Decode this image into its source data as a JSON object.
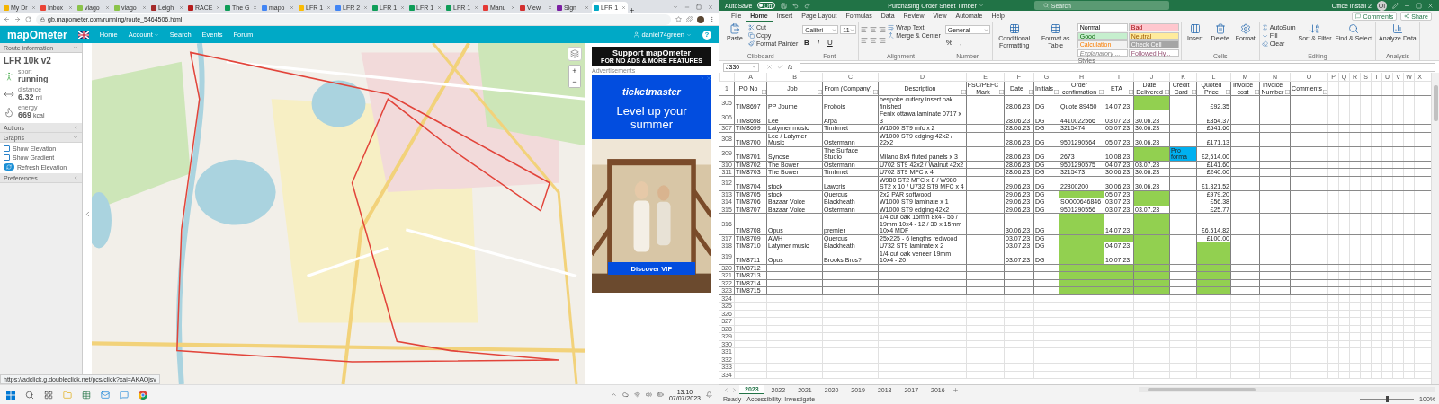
{
  "browser": {
    "tabs": [
      {
        "label": "My Dr",
        "color": "#f4b400",
        "selected": false
      },
      {
        "label": "Inbox",
        "color": "#ea4335",
        "selected": false
      },
      {
        "label": "viago",
        "color": "#8bc34a",
        "selected": false
      },
      {
        "label": "viago",
        "color": "#8bc34a",
        "selected": false
      },
      {
        "label": "Leigh",
        "color": "#a52a2a",
        "selected": false
      },
      {
        "label": "RACE",
        "color": "#b71c1c",
        "selected": false
      },
      {
        "label": "The G",
        "color": "#0f9d58",
        "selected": false
      },
      {
        "label": "mapo",
        "color": "#4285f4",
        "selected": false
      },
      {
        "label": "LFR 1",
        "color": "#fbbc04",
        "selected": false
      },
      {
        "label": "LFR 2",
        "color": "#4285f4",
        "selected": false
      },
      {
        "label": "LFR 1",
        "color": "#0f9d58",
        "selected": false
      },
      {
        "label": "LFR 1",
        "color": "#0f9d58",
        "selected": false
      },
      {
        "label": "LFR 1",
        "color": "#0f9d58",
        "selected": false
      },
      {
        "label": "Manu",
        "color": "#e53935",
        "selected": false
      },
      {
        "label": "View",
        "color": "#d32f2f",
        "selected": false
      },
      {
        "label": "Sign",
        "color": "#7b1fa2",
        "selected": false
      },
      {
        "label": "LFR 1",
        "color": "#00a9c6",
        "selected": true
      }
    ],
    "address": "gb.mapometer.com/running/route_5464506.html",
    "status_url": "https://adclick.g.doubleclick.net/pcs/click?xai=AKAOjsv"
  },
  "site": {
    "logo": "mapOmeter",
    "nav": [
      {
        "label": "Home",
        "dropdown": false
      },
      {
        "label": "Account",
        "dropdown": true
      },
      {
        "label": "Search",
        "dropdown": false
      },
      {
        "label": "Events",
        "dropdown": false
      },
      {
        "label": "Forum",
        "dropdown": false
      }
    ],
    "user": "daniel74green",
    "help": "?"
  },
  "sidebar": {
    "panel_title": "Route information",
    "route_name": "LFR 10k v2",
    "stats": [
      {
        "kind": "sport",
        "label": "sport",
        "value": "running"
      },
      {
        "kind": "distance",
        "label": "distance",
        "value": "6.32",
        "unit": "mi"
      },
      {
        "kind": "energy",
        "label": "energy",
        "value": "669",
        "unit": "kcal"
      }
    ],
    "sections": [
      {
        "label": "Actions",
        "expanded": false
      },
      {
        "label": "Graphs",
        "expanded": true,
        "options": [
          {
            "label": "Show Elevation",
            "checked": false
          },
          {
            "label": "Show Gradient",
            "checked": false
          }
        ],
        "button": "Refresh Elevation"
      },
      {
        "label": "Preferences",
        "expanded": false
      }
    ]
  },
  "map": {
    "kind": "picture",
    "zoom_in": "+",
    "zoom_out": "−"
  },
  "ad": {
    "support_title": "Support mapOmeter",
    "support_subtitle": "FOR NO ADS & MORE FEATURES",
    "label": "Advertisements",
    "brand": "ticketmaster",
    "headline": "Level up your summer",
    "cta": "Discover VIP"
  },
  "taskbar": {
    "time": "13:10",
    "date": "07/07/2023"
  },
  "excel": {
    "autosave": {
      "label": "AutoSave",
      "on": false,
      "state": "Off"
    },
    "title": "Purchasing Order Sheet Timber",
    "search": "Search",
    "account": "Office Install 2",
    "initials": "OI",
    "menu": [
      {
        "label": "File",
        "selected": false
      },
      {
        "label": "Home",
        "selected": true
      },
      {
        "label": "Insert",
        "selected": false
      },
      {
        "label": "Page Layout",
        "selected": false
      },
      {
        "label": "Formulas",
        "selected": false
      },
      {
        "label": "Data",
        "selected": false
      },
      {
        "label": "Review",
        "selected": false
      },
      {
        "label": "View",
        "selected": false
      },
      {
        "label": "Automate",
        "selected": false
      },
      {
        "label": "Help",
        "selected": false
      }
    ],
    "comments": "Comments",
    "share": "Share",
    "ribbon": [
      {
        "name": "Clipboard",
        "items": [
          {
            "kind": "big",
            "label": "Paste"
          },
          {
            "kind": "smalls",
            "labels": [
              "Cut",
              "Copy",
              "Format Painter"
            ]
          }
        ]
      },
      {
        "name": "Font",
        "items": [
          {
            "kind": "font",
            "selects": [
              "Calibri",
              "11"
            ],
            "glyphs": [
              "B",
              "I",
              "U"
            ]
          }
        ]
      },
      {
        "name": "Alignment",
        "items": [
          {
            "kind": "align"
          },
          {
            "kind": "smalls",
            "labels": [
              "Wrap Text",
              "Merge & Center"
            ]
          }
        ]
      },
      {
        "name": "Number",
        "items": [
          {
            "kind": "font",
            "selects": [
              "General"
            ],
            "glyphs": [
              "%",
              ","
            ]
          }
        ]
      },
      {
        "name": "Styles",
        "items": [
          {
            "kind": "big",
            "label": "Conditional Formatting"
          },
          {
            "kind": "big",
            "label": "Format as Table"
          },
          {
            "kind": "styles",
            "chips": [
              {
                "label": "Normal",
                "color": "#ffffff"
              },
              {
                "label": "Bad",
                "color": "#ffc7ce"
              },
              {
                "label": "Good",
                "color": "#c6efce"
              },
              {
                "label": "Neutral",
                "color": "#ffeb9c"
              },
              {
                "label": "Calculation",
                "color": "#f2f2f2"
              },
              {
                "label": "Check Cell",
                "color": "#a5a5a5"
              },
              {
                "label": "Explanatory ...",
                "color": "#ffffff"
              },
              {
                "label": "Followed Hy...",
                "color": "#ffffff"
              }
            ]
          }
        ]
      },
      {
        "name": "Cells",
        "items": [
          {
            "kind": "big",
            "label": "Insert"
          },
          {
            "kind": "big",
            "label": "Delete"
          },
          {
            "kind": "big",
            "label": "Format"
          }
        ]
      },
      {
        "name": "Editing",
        "items": [
          {
            "kind": "smalls",
            "labels": [
              "AutoSum",
              "Fill",
              "Clear"
            ]
          },
          {
            "kind": "big",
            "label": "Sort & Filter"
          },
          {
            "kind": "big",
            "label": "Find & Select"
          }
        ]
      },
      {
        "name": "Analysis",
        "items": [
          {
            "kind": "big",
            "label": "Analyze Data"
          }
        ]
      }
    ],
    "name_box": "J330",
    "fx": "fx",
    "column_letters": [
      "A",
      "B",
      "C",
      "D",
      "E",
      "F",
      "G",
      "H",
      "I",
      "J",
      "K",
      "L",
      "M",
      "N",
      "O",
      "P",
      "Q",
      "R",
      "S",
      "T",
      "U",
      "V",
      "W",
      "X"
    ],
    "header_row": {
      "num": "1",
      "cells": [
        "PO No",
        "Job",
        "From (Company)",
        "Description",
        "FSC/PEFC Mark",
        "Date",
        "Initials",
        "Order confirmation",
        "ETA",
        "Date Delivered",
        "Credit Card",
        "Quoted Price",
        "Invoice cost",
        "Invoice Number",
        "Comments"
      ]
    },
    "rows": [
      {
        "num": "305",
        "cells": [
          "TIM8697",
          "PP Journe",
          "Probois",
          "bespoke cutlery insert oak finished",
          {},
          "28.06.23",
          "DG",
          "Quote 89450",
          "14.07.23",
          {
            "color": "#92d050"
          },
          {},
          "£92.35"
        ]
      },
      {
        "num": "306",
        "cells": [
          "TIM8698",
          "Lee",
          "Arpa",
          "Fenix ottawa laminate 0717 x 3",
          {},
          "28.06.23",
          "DG",
          "4410022566",
          "03.07.23",
          "30.06.23",
          {},
          "£354.37"
        ]
      },
      {
        "num": "307",
        "cells": [
          "TIM8699",
          "Latymer music",
          "Timbmet",
          "W1000 ST9 mfc x 2",
          {},
          "28.06.23",
          "DG",
          "3215474",
          "05.07.23",
          "30.06.23",
          {},
          "£541.60"
        ]
      },
      {
        "num": "308",
        "cells": [
          "TIM8700",
          "Lee / Latymer Music",
          "Ostermann",
          "W1000 ST9 edging 42x2 / 22x2",
          {},
          "28.06.23",
          "DG",
          "9501290564",
          "05.07.23",
          "30.06.23",
          {},
          "£171.13"
        ]
      },
      {
        "num": "309",
        "cells": [
          "TIM8701",
          "Synose",
          "The Surface Studio",
          "Milano 8x4 fluted panels x 3",
          {},
          "28.06.23",
          "DG",
          "2673",
          "10.08.23",
          {
            "color": "#92d050"
          },
          {
            "text": "Pro forma",
            "color": "#00b0f0"
          },
          "£2,514.00"
        ]
      },
      {
        "num": "310",
        "cells": [
          "TIM8702",
          "The Bower",
          "Ostermann",
          "U702 ST9 42x2 / Walnut 42x2",
          {},
          "28.06.23",
          "DG",
          "9501290575",
          "04.07.23",
          "03.07.23",
          {},
          "£141.60"
        ]
      },
      {
        "num": "311",
        "cells": [
          "TIM8703",
          "The Bower",
          "Timbmet",
          "U702 ST9 MFC x 4",
          {},
          "28.06.23",
          "DG",
          "3215473",
          "30.06.23",
          "30.06.23",
          {},
          "£240.00"
        ]
      },
      {
        "num": "312",
        "cells": [
          "TIM8704",
          "stock",
          "Lawcris",
          "W980 ST2 MFC x 8 / W980 ST2 x 10 / U732 ST9 MFC x 4",
          {},
          "29.06.23",
          "DG",
          "22800200",
          "30.06.23",
          "30.06.23",
          {},
          "£1,321.52"
        ]
      },
      {
        "num": "313",
        "cells": [
          "TIM8705",
          "stock",
          "Quercus",
          "2x2 PAR softwood",
          {},
          "29.06.23",
          "DG",
          {
            "color": "#92d050"
          },
          "05.07.23",
          {
            "color": "#92d050"
          },
          {},
          "£979.20"
        ]
      },
      {
        "num": "314",
        "cells": [
          "TIM8706",
          "Bazaar Voice",
          "Blackheath",
          "W1000 ST9 laminate x 1",
          {},
          "29.06.23",
          "DG",
          "SO000646846",
          "03.07.23",
          {
            "color": "#92d050"
          },
          {},
          "£56.38"
        ]
      },
      {
        "num": "315",
        "cells": [
          "TIM8707",
          "Bazaar Voice",
          "Ostermann",
          "W1000 ST9 edging 42x2",
          {},
          "29.06.23",
          "DG",
          "9501290556",
          "03.07.23",
          "03.07.23",
          {},
          "£25.77"
        ]
      },
      {
        "num": "316",
        "cells": [
          "TIM8708",
          "Opus",
          "premier",
          "1/4 cut oak 15mm 8x4 - 55 / 19mm 10x4 - 12 / 30 x 15mm 10x4 MDF",
          {},
          "30.06.23",
          "DG",
          {
            "color": "#92d050"
          },
          "14.07.23",
          {
            "color": "#92d050"
          },
          {},
          "£6,514.82"
        ]
      },
      {
        "num": "317",
        "cells": [
          "TIM8709",
          "AWH",
          "Quercus",
          "25x225 - 6 lengths redwood",
          {},
          "03.07.23",
          "DG",
          {
            "color": "#92d050"
          },
          {
            "color": "#92d050"
          },
          {
            "color": "#92d050"
          },
          {},
          "£100.00"
        ]
      },
      {
        "num": "318",
        "cells": [
          "TIM8710",
          "Latymer music",
          "Blackheath",
          "U732 ST9 laminate x 2",
          {},
          "03.07.23",
          "DG",
          {
            "color": "#92d050"
          },
          "04.07.23",
          {
            "color": "#92d050"
          },
          {},
          {
            "color": "#92d050"
          }
        ]
      },
      {
        "num": "319",
        "cells": [
          "TIM8711",
          "Opus",
          "Brooks Bros?",
          "1/4 cut oak veneer 19mm 10x4 - 20",
          {},
          "03.07.23",
          "DG",
          {
            "color": "#92d050"
          },
          "10.07.23",
          {
            "color": "#92d050"
          },
          {},
          {
            "color": "#92d050"
          }
        ]
      },
      {
        "num": "320",
        "cells": [
          "TIM8712",
          {},
          {},
          {},
          {},
          {},
          {},
          {
            "color": "#92d050"
          },
          {
            "color": "#92d050"
          },
          {
            "color": "#92d050"
          },
          {},
          {
            "color": "#92d050"
          }
        ]
      },
      {
        "num": "321",
        "cells": [
          "TIM8713",
          {},
          {},
          {},
          {},
          {},
          {},
          {
            "color": "#92d050"
          },
          {
            "color": "#92d050"
          },
          {
            "color": "#92d050"
          },
          {},
          {
            "color": "#92d050"
          }
        ]
      },
      {
        "num": "322",
        "cells": [
          "TIM8714",
          {},
          {},
          {},
          {},
          {},
          {},
          {
            "color": "#92d050"
          },
          {
            "color": "#92d050"
          },
          {
            "color": "#92d050"
          },
          {},
          {
            "color": "#92d050"
          }
        ]
      },
      {
        "num": "323",
        "cells": [
          "TIM8715",
          {},
          {},
          {},
          {},
          {},
          {},
          {
            "color": "#92d050"
          },
          {
            "color": "#92d050"
          },
          {
            "color": "#92d050"
          },
          {},
          {
            "color": "#92d050"
          }
        ]
      }
    ],
    "empty_rows": [
      "324",
      "325",
      "326",
      "327",
      "328",
      "329",
      "330",
      "331",
      "332",
      "333",
      "334"
    ],
    "sheet_tabs": [
      {
        "label": "2023",
        "selected": true
      },
      {
        "label": "2022",
        "selected": false
      },
      {
        "label": "2021",
        "selected": false
      },
      {
        "label": "2020",
        "selected": false
      },
      {
        "label": "2019",
        "selected": false
      },
      {
        "label": "2018",
        "selected": false
      },
      {
        "label": "2017",
        "selected": false
      },
      {
        "label": "2016",
        "selected": false
      }
    ],
    "status": {
      "ready": "Ready",
      "accessibility": "Accessibility: Investigate",
      "zoom": "100%",
      "zoom_slider": {
        "level": 0.5
      }
    }
  }
}
